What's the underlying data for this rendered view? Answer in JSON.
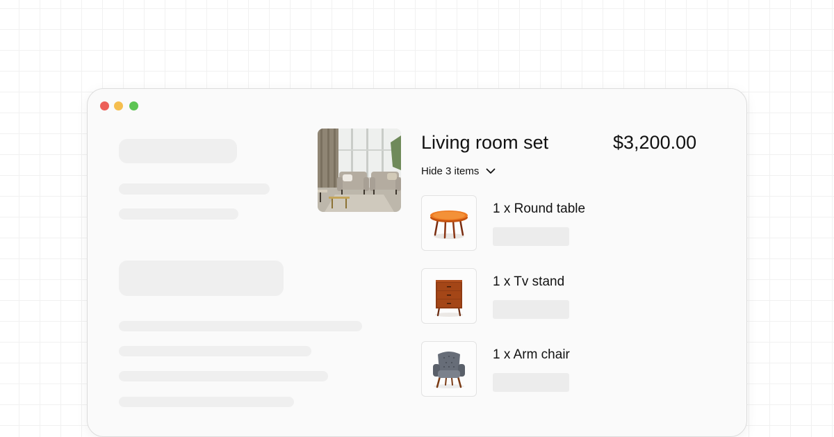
{
  "window": {
    "controls": [
      {
        "name": "close",
        "color": "#ec5f59"
      },
      {
        "name": "minimize",
        "color": "#f5be4f"
      },
      {
        "name": "maximize",
        "color": "#5dc453"
      }
    ]
  },
  "product": {
    "title": "Living room set",
    "price": "$3,200.00",
    "toggle_label": "Hide 3 items",
    "image": "living-room-photo"
  },
  "items": [
    {
      "label": "1 x Round table",
      "icon": "round-table-image"
    },
    {
      "label": "1 x Tv stand",
      "icon": "tv-stand-image"
    },
    {
      "label": "1 x Arm chair",
      "icon": "arm-chair-image"
    }
  ]
}
